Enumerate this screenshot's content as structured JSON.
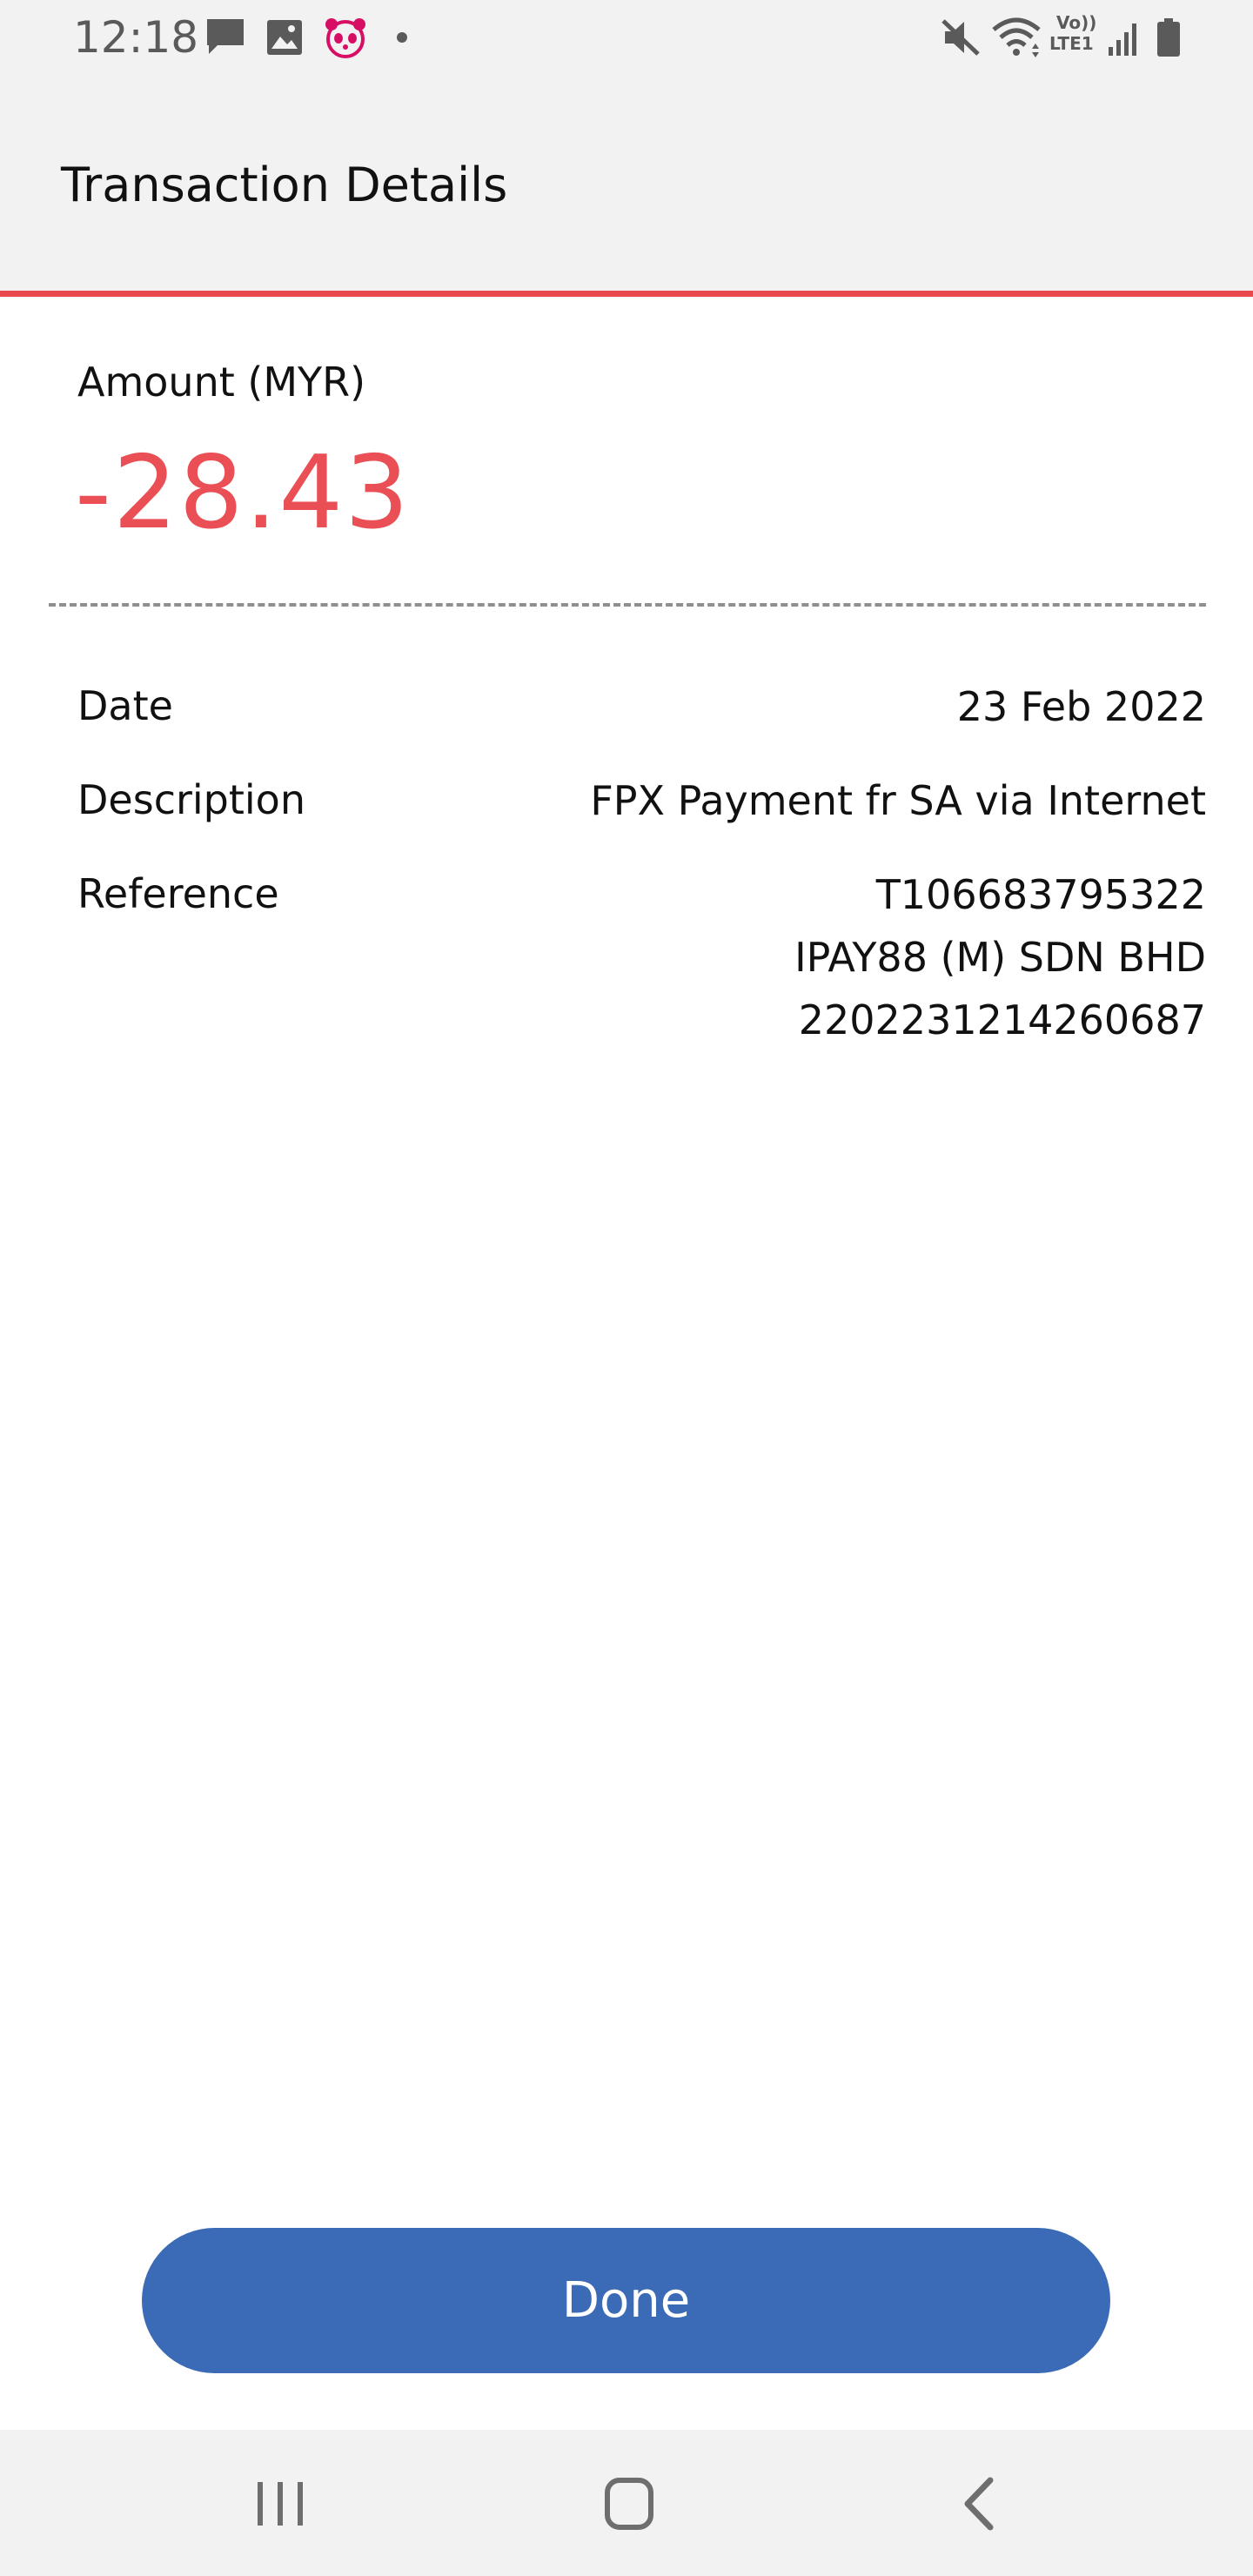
{
  "status_bar": {
    "time": "12:18",
    "icons_left": [
      "message-icon",
      "image-icon",
      "foodpanda-icon",
      "dot-icon"
    ],
    "icons_right": [
      "mute-icon",
      "wifi-icon",
      "volte-icon",
      "signal-icon",
      "battery-icon"
    ],
    "volte_text": "Vo))",
    "lte_text": "LTE1"
  },
  "header": {
    "title": "Transaction Details"
  },
  "amount": {
    "label": "Amount (MYR)",
    "value": "-28.43"
  },
  "details": {
    "date": {
      "label": "Date",
      "value": "23 Feb 2022"
    },
    "description": {
      "label": "Description",
      "value": "FPX Payment fr SA via Internet"
    },
    "reference": {
      "label": "Reference",
      "lines": [
        "T106683795322",
        "IPAY88 (M) SDN BHD",
        "2202231214260687"
      ]
    }
  },
  "done_button": {
    "label": "Done"
  },
  "nav_bar": {
    "buttons": [
      "recent-apps-icon",
      "home-icon",
      "back-icon"
    ]
  },
  "colors": {
    "accent_red": "#e8474c",
    "amount_red": "#ea4f55",
    "button_blue": "#3b6ab6",
    "header_bg": "#f2f2f2"
  }
}
